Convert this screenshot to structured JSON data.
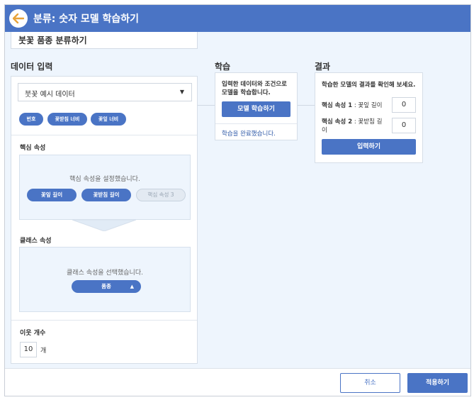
{
  "header": {
    "title": "분류: 숫자 모델 학습하기",
    "back_icon": "arrow-left-icon"
  },
  "project": {
    "name": "붓꽃 품종 분류하기"
  },
  "data_input": {
    "title": "데이터 입력",
    "dataset_selected": "붓꽃 예시 데이터",
    "columns": [
      "번호",
      "꽃받침 너비",
      "꽃잎 너비"
    ],
    "core": {
      "title": "핵심 속성",
      "hint": "핵심 속성을 설정했습니다.",
      "pills": [
        "꽃잎 길이",
        "꽃받침 길이"
      ],
      "empty_slot": "핵심 속성 3"
    },
    "class": {
      "title": "클래스 속성",
      "hint": "클래스 속성을 선택했습니다.",
      "selected": "품종"
    },
    "neighbors": {
      "title": "이웃 개수",
      "value": "10",
      "unit": "개"
    }
  },
  "learn": {
    "title": "학습",
    "desc_line1": "입력한 데이터와 조건으로",
    "desc_line2": "모델을 학습합니다.",
    "button": "모델 학습하기",
    "status": "학습을 완료했습니다."
  },
  "result": {
    "title": "결과",
    "desc": "학습한 모델의 결과를 확인해 보세요.",
    "attr1_label": "핵심 속성 1",
    "attr1_name": "꽃잎 길이",
    "attr1_value": "0",
    "attr2_label": "핵심 속성 2",
    "attr2_name_line1": "꽃받침 길",
    "attr2_name_line2": "이",
    "attr2_value": "0",
    "button": "입력하기"
  },
  "footer": {
    "cancel": "취소",
    "apply": "적용하기"
  },
  "colors": {
    "accent": "#4a74c5",
    "background": "#eef5fd",
    "back_icon": "#e8a33a"
  }
}
